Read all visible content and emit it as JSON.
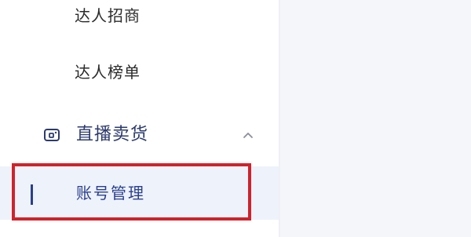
{
  "sidebar": {
    "items_above": [
      {
        "label": "达人招商"
      },
      {
        "label": "达人榜单"
      }
    ],
    "group": {
      "label": "直播卖货",
      "icon": "live-stream-icon",
      "expanded": true,
      "chevron_icon": "chevron-up-icon"
    },
    "active_item": {
      "label": "账号管理",
      "highlighted": true
    }
  },
  "colors": {
    "accent": "#2a3f8c",
    "group_text": "#2d3b6e",
    "active_bg": "#eef2fb",
    "highlight_border": "#d1222b",
    "content_bg": "#f5f6f9"
  }
}
